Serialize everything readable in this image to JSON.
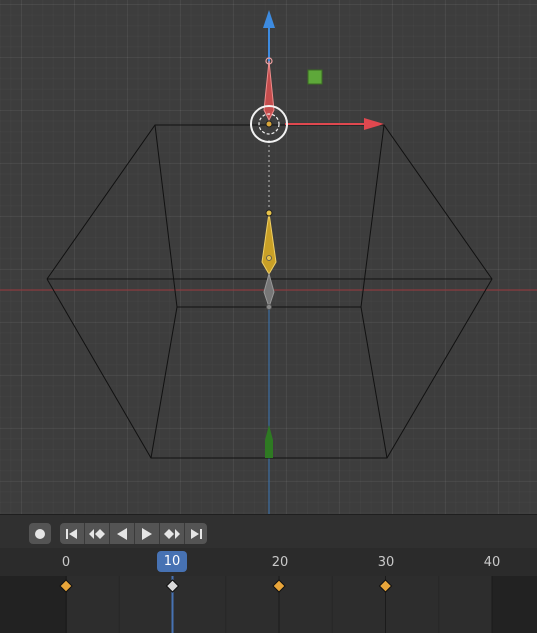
{
  "viewport": {
    "colors": {
      "x_axis": "#e0484f",
      "y_axis": "#5ea83a",
      "z_axis": "#3d8be0",
      "bone_active": "#d2a630",
      "bone_selected_tip": "#e56d6d"
    }
  },
  "timeline": {
    "controls": {
      "record": "record-icon",
      "jump_start": "jump-to-start-icon",
      "prev_keyframe": "previous-keyframe-icon",
      "play_reverse": "play-reverse-icon",
      "play": "play-icon",
      "next_keyframe": "next-keyframe-icon",
      "jump_end": "jump-to-end-icon"
    },
    "ruler": {
      "ticks": [
        "0",
        "20",
        "30",
        "40"
      ],
      "current_frame": "10"
    },
    "keyframes": [
      0,
      10,
      20,
      30
    ],
    "colors": {
      "keyframe": "#e8a53a",
      "keyframe_selected": "#d9d9d9",
      "playhead": "#4772b3"
    }
  }
}
